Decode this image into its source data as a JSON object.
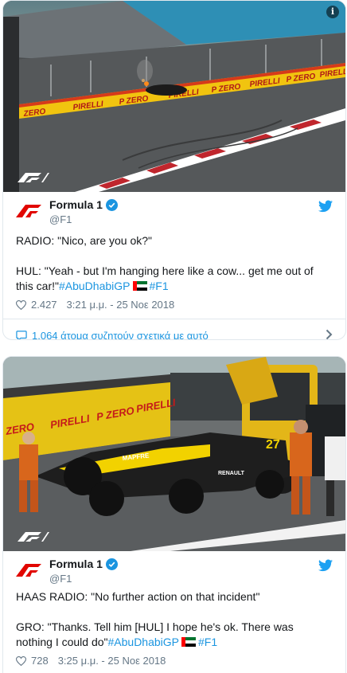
{
  "tweets": [
    {
      "author_name": "Formula 1",
      "handle": "@F1",
      "text_line1": "RADIO: \"Nico, are you ok?\"",
      "text_line2": "HUL: \"Yeah - but I'm hanging here like a cow... get me out of this car!\"",
      "hashtag1": "#AbuDhabiGP",
      "hashtag2": "#F1",
      "likes": "2.427",
      "timestamp": "3:21 μ.μ. - 25 Νοε 2018",
      "conversation": "1.064 άτομα συζητούν σχετικά με αυτό",
      "photo_banners": [
        "ZERO",
        "PIRELLI",
        "P ZERO",
        "PIRELLI",
        "P ZERO",
        "PIRELLI",
        "P ZERO",
        "PIRELLI"
      ]
    },
    {
      "author_name": "Formula 1",
      "handle": "@F1",
      "text_line1": "HAAS RADIO: \"No further action on that incident\"",
      "text_line2": "GRO: \"Thanks. Tell him [HUL] I hope he's ok. There was nothing I could do\"",
      "hashtag1": "#AbuDhabiGP",
      "hashtag2": "#F1",
      "likes": "728",
      "timestamp": "3:25 μ.μ. - 25 Νοε 2018",
      "photo_banners": [
        "ZERO",
        "PIRELLI",
        "P ZERO",
        "PIRELLI"
      ],
      "car_number": "27",
      "car_sponsor": "MAPFRE",
      "car_brand": "RENAULT"
    }
  ],
  "info_badge": "i",
  "colors": {
    "accent": "#1b95e0",
    "f1_red": "#e10600",
    "muted": "#657786"
  }
}
